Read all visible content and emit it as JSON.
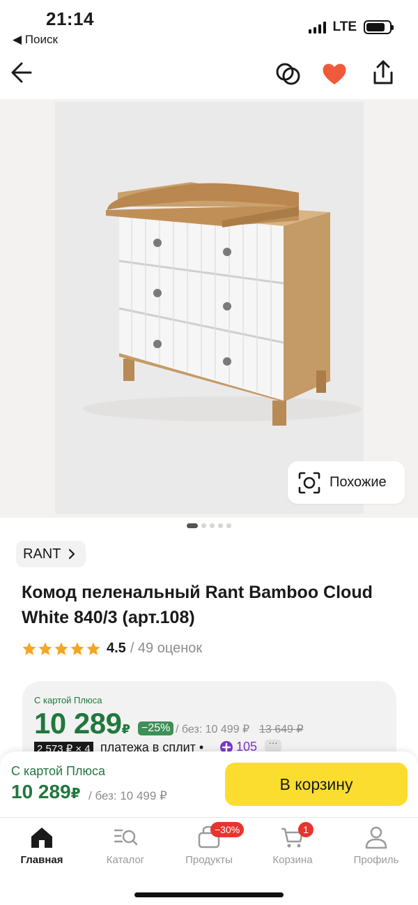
{
  "status_bar": {
    "time": "21:14",
    "back_label": "◀ Поиск",
    "network": "LTE"
  },
  "gallery": {
    "similar_label": "Похожие",
    "dots_count": 5,
    "active_dot": 0
  },
  "product": {
    "brand": "RANT",
    "title": "Комод пеленальный Rant Bamboo Cloud White 840/3 (арт.108)",
    "rating": "4.5",
    "rating_count": "/ 49 оценок",
    "stars": 5
  },
  "price_card": {
    "label": "С картой Плюса",
    "price": "10 289",
    "currency": "₽",
    "discount": "−25%",
    "without_card": "/ без: 10 499 ₽",
    "old_price": "13 649 ₽",
    "split_badge": "2 573 ₽ × 4",
    "split_text": "платежа в сплит •",
    "plus_points": "105",
    "more": "···"
  },
  "buy_panel": {
    "label": "С картой Плюса",
    "price": "10 289",
    "currency": "₽",
    "without_card": "/ без: 10 499 ₽",
    "cart_button": "В корзину"
  },
  "tab_bar": {
    "items": [
      {
        "label": "Главная",
        "icon": "home-icon",
        "active": true
      },
      {
        "label": "Каталог",
        "icon": "catalog-search-icon",
        "active": false
      },
      {
        "label": "Продукты",
        "icon": "grocery-bag-icon",
        "active": false,
        "badge": "−30%"
      },
      {
        "label": "Корзина",
        "icon": "cart-icon",
        "active": false,
        "badge": "1"
      },
      {
        "label": "Профиль",
        "icon": "profile-icon",
        "active": false
      }
    ]
  },
  "colors": {
    "accent_yellow": "#fbdd2f",
    "plus_green": "#22773d",
    "favorite_red": "#f05a3a",
    "badge_red": "#e8342e",
    "plus_purple": "#7b35c8"
  }
}
